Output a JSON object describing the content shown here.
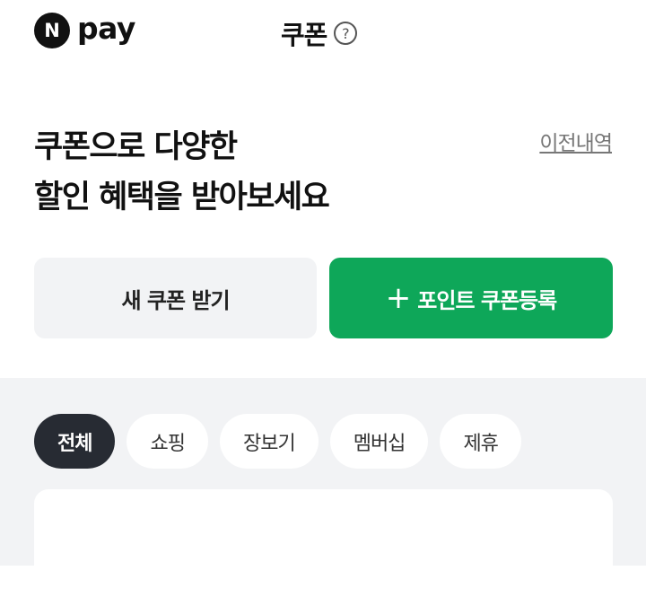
{
  "header": {
    "logo_mark": "N",
    "logo_text": "pay",
    "title": "쿠폰",
    "help_glyph": "?"
  },
  "hero": {
    "headline_line1": "쿠폰으로 다양한",
    "headline_line2": "할인 혜택을 받아보세요",
    "history_link": "이전내역"
  },
  "actions": {
    "new_coupon": "새 쿠폰 받기",
    "register_plus": "+",
    "register_label": "포인트 쿠폰등록",
    "register_color": "#0ea759"
  },
  "tabs": [
    {
      "label": "전체",
      "active": true
    },
    {
      "label": "쇼핑",
      "active": false
    },
    {
      "label": "장보기",
      "active": false
    },
    {
      "label": "멤버십",
      "active": false
    },
    {
      "label": "제휴",
      "active": false
    }
  ],
  "icons": [
    "help-icon",
    "plus-icon"
  ]
}
